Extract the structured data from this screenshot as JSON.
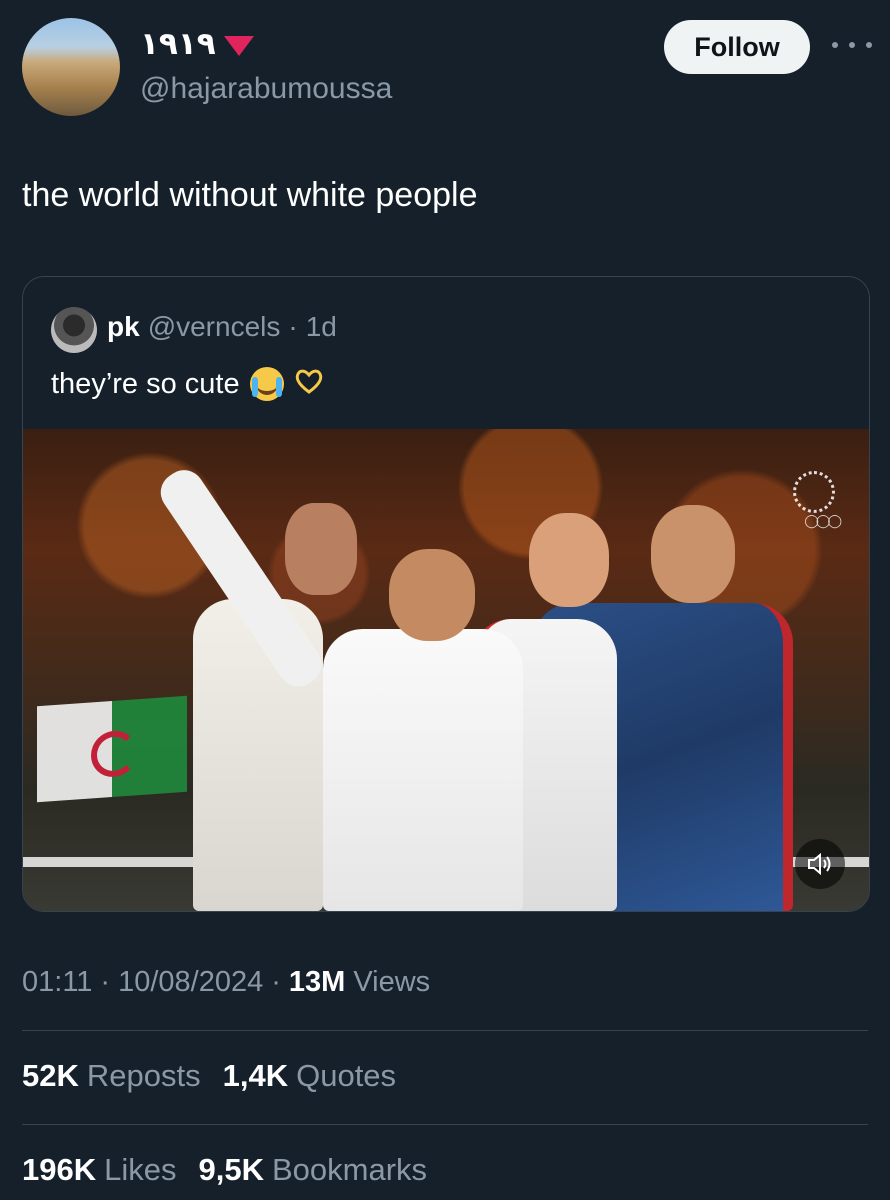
{
  "header": {
    "display_name": "١٩١٩",
    "handle": "@hajarabumoussa",
    "follow_label": "Follow"
  },
  "tweet": {
    "text": "the world without white people"
  },
  "quote": {
    "name": "pk",
    "handle": "@verncels",
    "separator": "·",
    "time": "1d",
    "text": "they’re so cute"
  },
  "meta": {
    "time": "01:11",
    "sep1": "·",
    "date": "10/08/2024",
    "sep2": "·",
    "views_count": "13M",
    "views_label": "Views"
  },
  "stats": {
    "reposts_count": "52K",
    "reposts_label": "Reposts",
    "quotes_count": "1,4K",
    "quotes_label": "Quotes",
    "likes_count": "196K",
    "likes_label": "Likes",
    "bookmarks_count": "9,5K",
    "bookmarks_label": "Bookmarks"
  },
  "colors": {
    "background": "#15202b",
    "secondary_text": "#8b98a5",
    "border": "#38444d",
    "follow_bg": "#eff3f4"
  },
  "icons": [
    "red-triangle-icon",
    "more-icon",
    "cry-emoji-icon",
    "heart-hands-emoji-icon",
    "volume-icon"
  ]
}
